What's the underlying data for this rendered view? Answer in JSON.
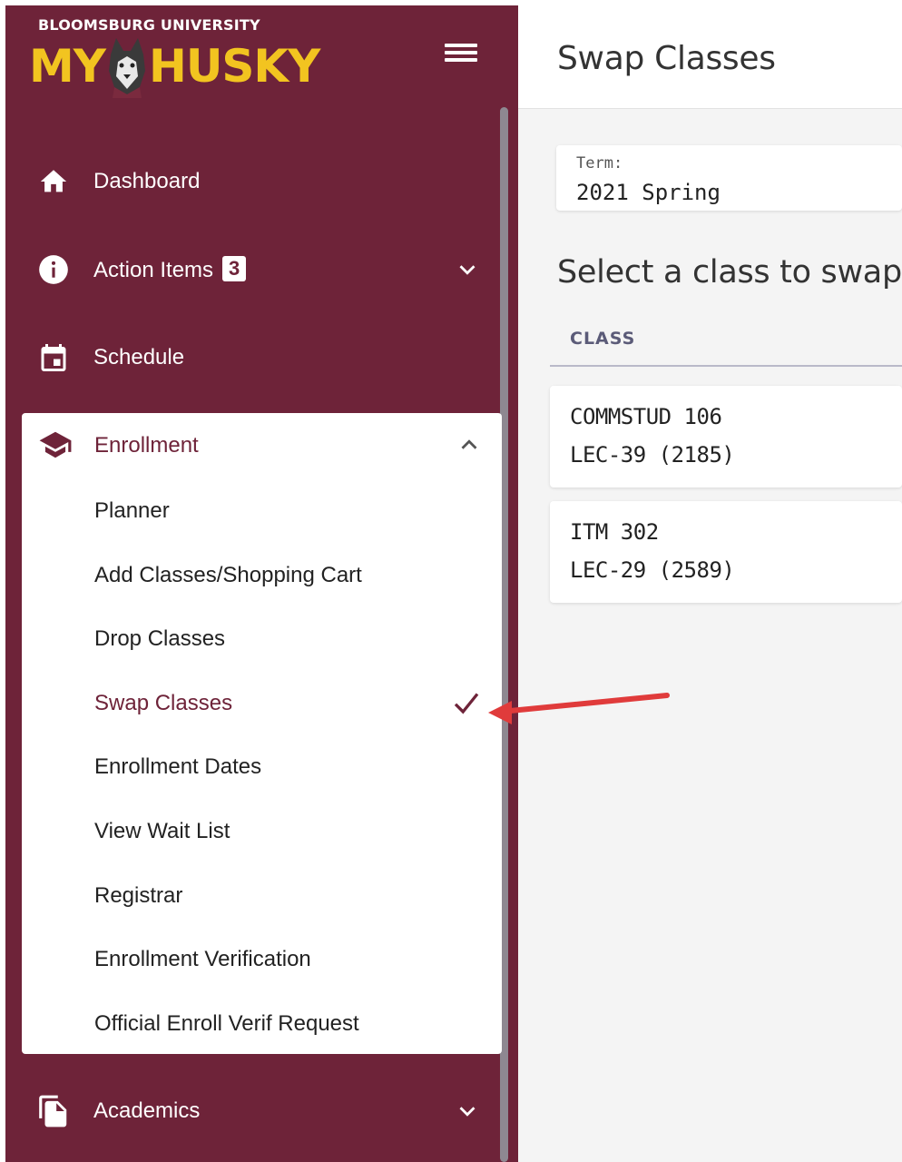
{
  "brand": {
    "top": "BLOOMSBURG UNIVERSITY",
    "left": "MY",
    "right": "HUSKY",
    "colors": {
      "primary": "#6e2339",
      "gold": "#f2c420"
    }
  },
  "sidebar": {
    "items": [
      {
        "label": "Dashboard",
        "icon": "home-icon"
      },
      {
        "label": "Action Items",
        "icon": "info-icon",
        "badge": "3"
      },
      {
        "label": "Schedule",
        "icon": "calendar-icon"
      },
      {
        "label": "Enrollment",
        "icon": "graduation-cap-icon",
        "expanded": true
      },
      {
        "label": "Academics",
        "icon": "documents-icon"
      }
    ],
    "enrollment_children": [
      "Planner",
      "Add Classes/Shopping Cart",
      "Drop Classes",
      "Swap Classes",
      "Enrollment Dates",
      "View Wait List",
      "Registrar",
      "Enrollment Verification",
      "Official Enroll Verif Request"
    ],
    "active_child": "Swap Classes"
  },
  "page": {
    "title": "Swap Classes",
    "term_label": "Term:",
    "term_value": "2021 Spring",
    "section_title": "Select a class to swap",
    "column_header": "CLASS",
    "classes": [
      {
        "course": "COMMSTUD 106",
        "section": "LEC-39 (2185)"
      },
      {
        "course": "ITM 302",
        "section": "LEC-29 (2589)"
      }
    ]
  },
  "annotation": {
    "arrow_color": "#e03b3b"
  }
}
